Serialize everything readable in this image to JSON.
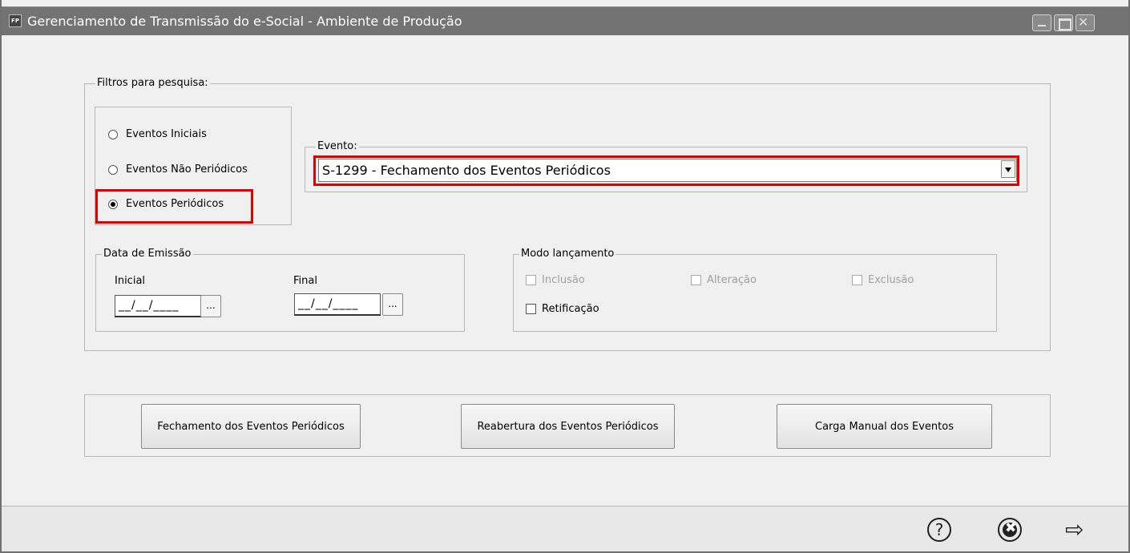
{
  "window": {
    "title": "Gerenciamento de Transmissão do e-Social - Ambiente de Produção",
    "icon_text": "FP"
  },
  "filters": {
    "group_label": "Filtros para pesquisa:",
    "radio_options": [
      {
        "label": "Eventos Iniciais",
        "selected": false
      },
      {
        "label": "Eventos Não Periódicos",
        "selected": false
      },
      {
        "label": "Eventos Periódicos",
        "selected": true
      }
    ],
    "evento": {
      "label": "Evento:",
      "value": "S-1299 - Fechamento dos Eventos Periódicos"
    },
    "data_emissao": {
      "label": "Data de Emissão",
      "inicial_label": "Inicial",
      "inicial_value": "__/__/____",
      "final_label": "Final",
      "final_value": "__/__/____",
      "picker_label": "..."
    },
    "modo_lancamento": {
      "label": "Modo lançamento",
      "options": [
        {
          "label": "Inclusão",
          "checked": false,
          "enabled": false
        },
        {
          "label": "Alteração",
          "checked": false,
          "enabled": false
        },
        {
          "label": "Exclusão",
          "checked": false,
          "enabled": false
        },
        {
          "label": "Retificação",
          "checked": false,
          "enabled": true
        }
      ]
    }
  },
  "actions": {
    "fechamento": "Fechamento dos Eventos Periódicos",
    "reabertura": "Reabertura dos Eventos Periódicos",
    "carga_manual": "Carga Manual dos Eventos"
  },
  "footer": {
    "help_glyph": "?",
    "cancel_glyph": "✖",
    "next_glyph": "⇨"
  },
  "colors": {
    "titlebar": "#737373",
    "highlight": "#e00000",
    "window_bg": "#f0f0f0"
  }
}
